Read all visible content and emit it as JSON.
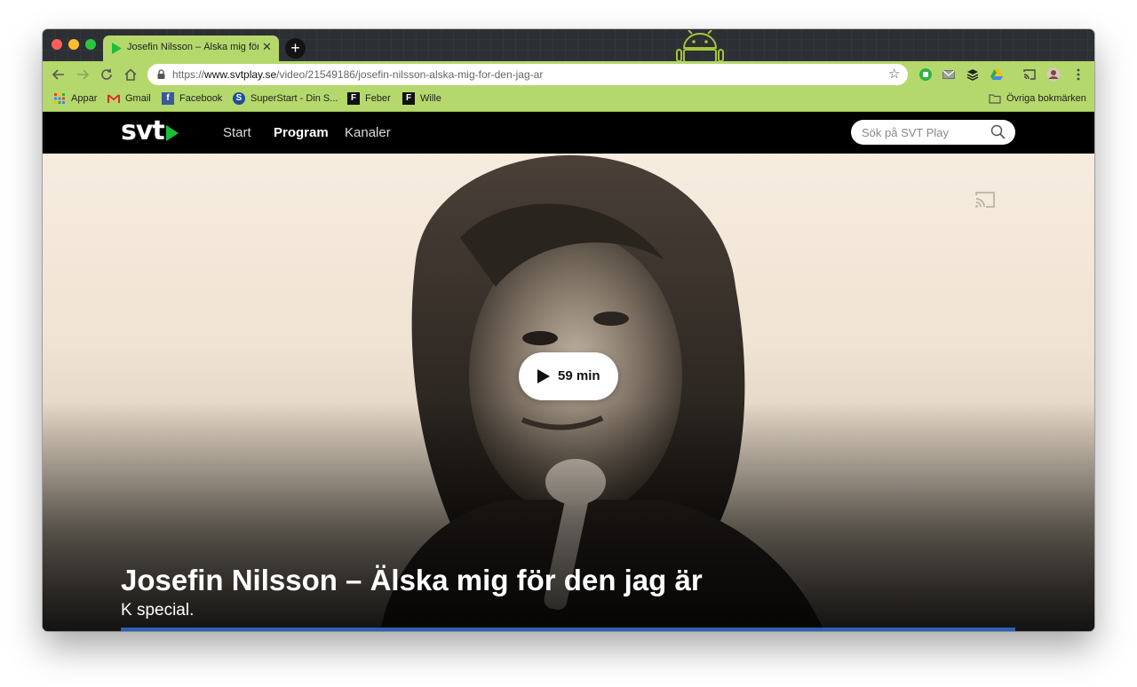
{
  "browser": {
    "tab": {
      "title": "Josefin Nilsson – Älska mig för den jag är | SVT Play",
      "close_glyph": "✕"
    },
    "new_tab_glyph": "+",
    "address": {
      "scheme": "https://",
      "host": "www.svtplay.se",
      "path": "/video/21549186/josefin-nilsson-alska-mig-for-den-jag-ar"
    },
    "bookmarks": [
      {
        "label": "Appar",
        "icon": "apps-grid-icon"
      },
      {
        "label": "Gmail",
        "icon": "gmail-icon"
      },
      {
        "label": "Facebook",
        "icon": "facebook-icon"
      },
      {
        "label": "SuperStart - Din S...",
        "icon": "superstart-icon"
      },
      {
        "label": "Feber",
        "icon": "feber-icon"
      },
      {
        "label": "Wille",
        "icon": "wille-icon"
      }
    ],
    "other_bookmarks": "Övriga bokmärken",
    "theme_color": "#b5d86c"
  },
  "svt": {
    "logo_text": "svt",
    "nav": [
      "Start",
      "Program",
      "Kanaler"
    ],
    "active_nav": "Program",
    "search_placeholder": "Sök på SVT Play",
    "accent": "#1bbf3b"
  },
  "video": {
    "duration_label": "59 min",
    "title": "Josefin Nilsson – Älska mig för den jag är",
    "subtitle": "K special.",
    "progress_color": "#2a62b8"
  }
}
